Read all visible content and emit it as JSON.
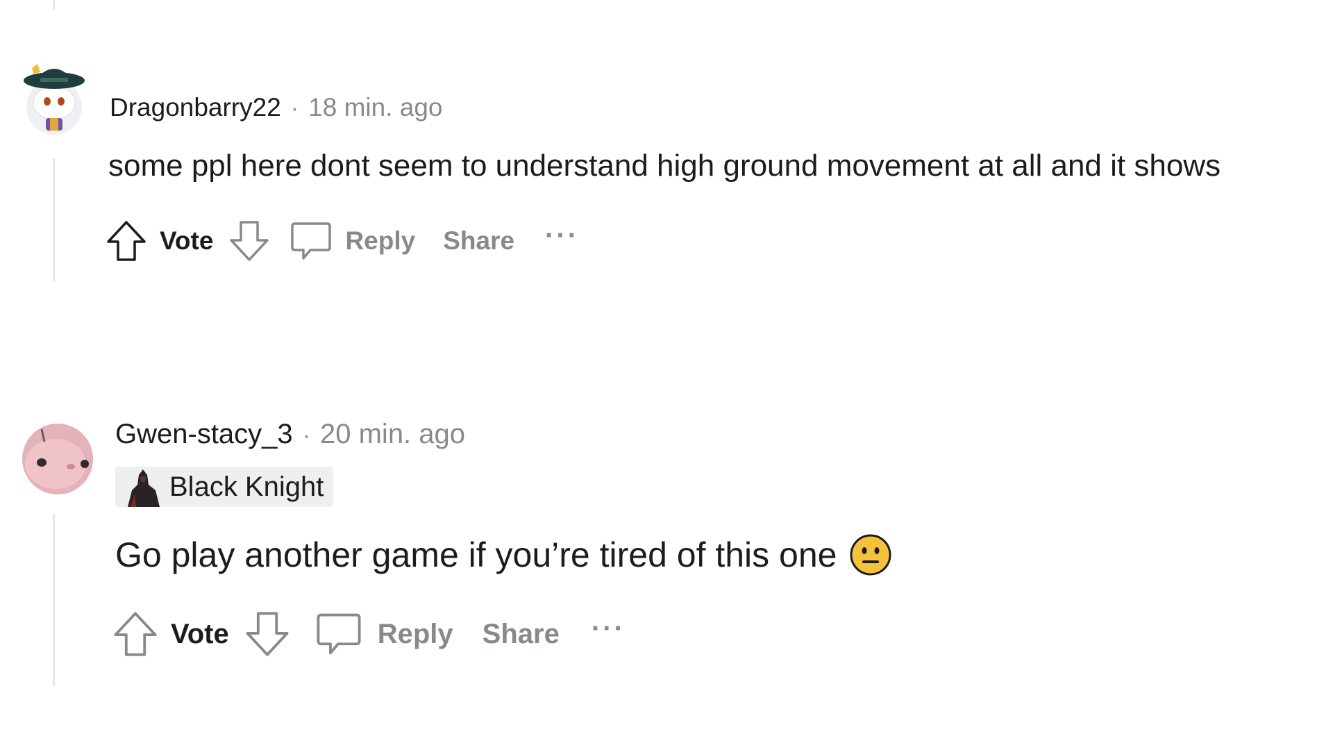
{
  "comments": [
    {
      "username": "Dragonbarry22",
      "separator": "·",
      "time": "18 min. ago",
      "body": "some ppl here dont seem to understand high ground movement at all and it shows",
      "actions": {
        "vote_label": "Vote",
        "reply_label": "Reply",
        "share_label": "Share",
        "more_label": "···"
      }
    },
    {
      "username": "Gwen-stacy_3",
      "separator": "·",
      "time": "20 min. ago",
      "flair": "Black Knight",
      "body": "Go play another game if you’re tired of this one",
      "emoji": "neutral-face",
      "actions": {
        "vote_label": "Vote",
        "reply_label": "Reply",
        "share_label": "Share",
        "more_label": "···"
      }
    }
  ],
  "colors": {
    "text": "#1c1c1c",
    "muted": "#878a8c",
    "thread_line": "#e6e6e6",
    "flair_bg": "#edeff1",
    "emoji": "#f5c33b"
  },
  "icons": [
    "upvote-icon",
    "downvote-icon",
    "comment-icon",
    "neutral-face-icon",
    "black-knight-flair-icon"
  ]
}
